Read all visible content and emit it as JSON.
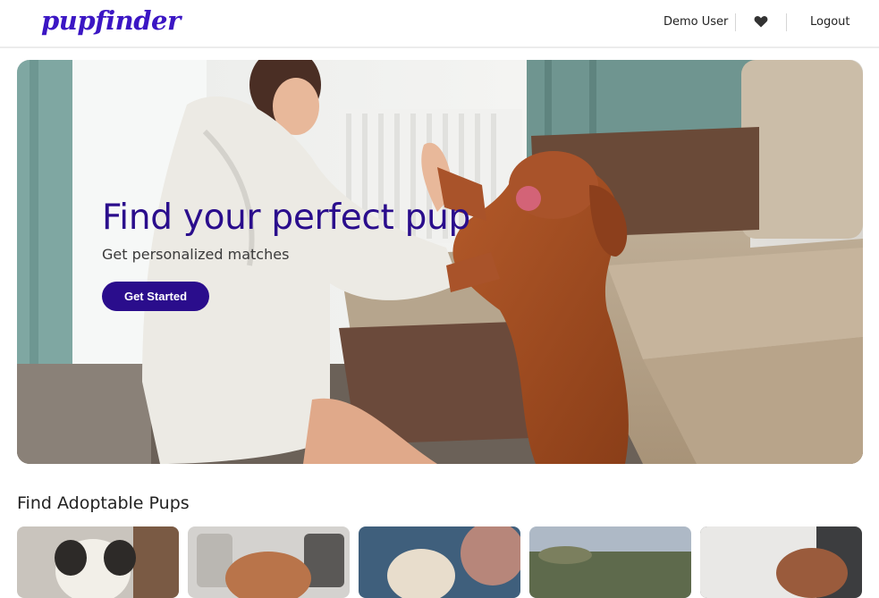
{
  "header": {
    "logo_text": "pupfinder",
    "user_name": "Demo User",
    "favorites_icon": "heart-icon",
    "logout_label": "Logout"
  },
  "hero": {
    "title": "Find your perfect pup",
    "subtitle": "Get personalized matches",
    "cta_label": "Get Started"
  },
  "adoptable": {
    "section_title": "Find Adoptable Pups",
    "cards": [
      {
        "name": "pup-card-1"
      },
      {
        "name": "pup-card-2"
      },
      {
        "name": "pup-card-3"
      },
      {
        "name": "pup-card-4"
      },
      {
        "name": "pup-card-5"
      }
    ]
  },
  "colors": {
    "brand": "#3b16c4",
    "cta": "#2a0d8c",
    "header_border": "#ececec"
  }
}
